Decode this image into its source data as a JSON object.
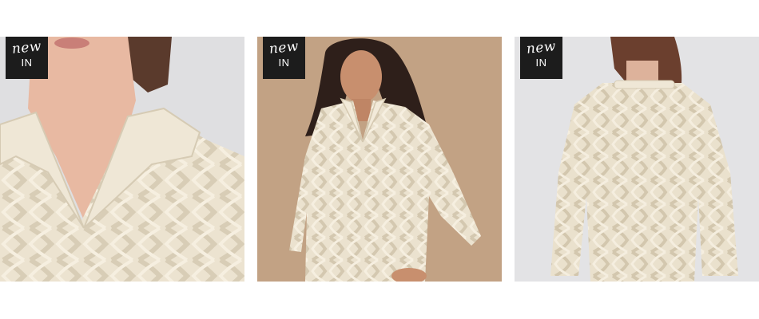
{
  "products": [
    {
      "image_subject": "cream cable knit collared sweater close-up",
      "badge": {
        "script": "new",
        "caps": "IN"
      }
    },
    {
      "image_subject": "woman wearing cream cable knit collared sweater",
      "badge": {
        "script": "new",
        "caps": "IN"
      }
    },
    {
      "image_subject": "back view of cream cable knit sweater",
      "badge": {
        "script": "new",
        "caps": "IN"
      }
    }
  ],
  "colors": {
    "background": "#ffffff",
    "badge": "#1c1c1c",
    "sweater": "#ebe2cf",
    "studio_bg_light": "#e4e4e6",
    "studio_bg_tan": "#c5a587"
  }
}
